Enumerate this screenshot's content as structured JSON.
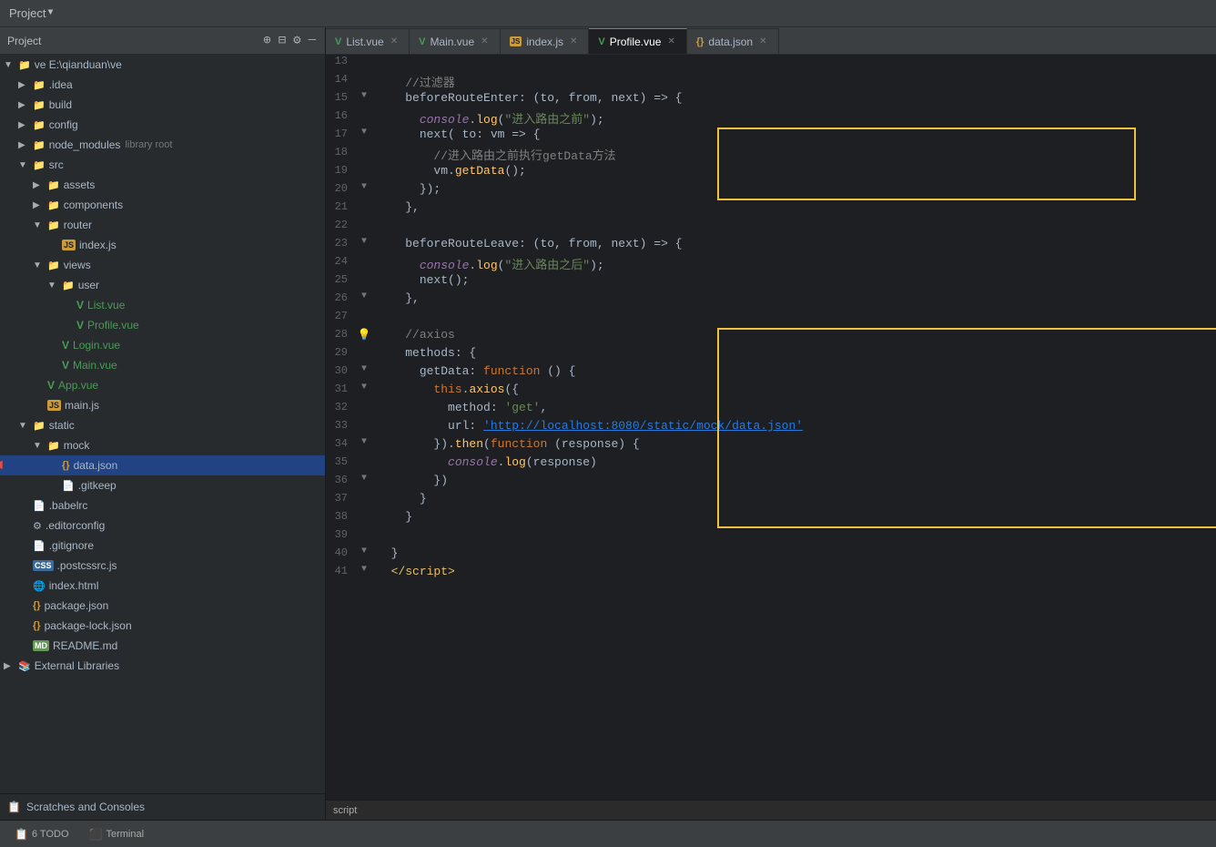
{
  "titleBar": {
    "title": "Project",
    "dropdownIcon": "▼"
  },
  "sidebar": {
    "header": {
      "title": "Project",
      "icons": [
        "+",
        "⊟",
        "⚙",
        "—"
      ]
    },
    "tree": [
      {
        "id": "ve-root",
        "level": 0,
        "arrow": "▼",
        "icon": "📁",
        "iconClass": "folder-blue",
        "label": "ve E:\\qianduan\\ve",
        "labelClass": ""
      },
      {
        "id": "idea",
        "level": 1,
        "arrow": "▶",
        "icon": "📁",
        "iconClass": "folder",
        "label": ".idea",
        "labelClass": ""
      },
      {
        "id": "build",
        "level": 1,
        "arrow": "▶",
        "icon": "📁",
        "iconClass": "folder",
        "label": "build",
        "labelClass": ""
      },
      {
        "id": "config",
        "level": 1,
        "arrow": "▶",
        "icon": "📁",
        "iconClass": "folder",
        "label": "config",
        "labelClass": ""
      },
      {
        "id": "node_modules",
        "level": 1,
        "arrow": "▶",
        "icon": "📁",
        "iconClass": "folder",
        "label": "node_modules",
        "extra": "library root",
        "labelClass": ""
      },
      {
        "id": "src",
        "level": 1,
        "arrow": "▼",
        "icon": "📁",
        "iconClass": "folder",
        "label": "src",
        "labelClass": ""
      },
      {
        "id": "assets",
        "level": 2,
        "arrow": "▶",
        "icon": "📁",
        "iconClass": "folder",
        "label": "assets",
        "labelClass": ""
      },
      {
        "id": "components",
        "level": 2,
        "arrow": "▶",
        "icon": "📁",
        "iconClass": "folder",
        "label": "components",
        "labelClass": ""
      },
      {
        "id": "router",
        "level": 2,
        "arrow": "▼",
        "icon": "📁",
        "iconClass": "folder",
        "label": "router",
        "labelClass": ""
      },
      {
        "id": "router-index",
        "level": 3,
        "arrow": "",
        "icon": "JS",
        "iconClass": "js-icon",
        "label": "index.js",
        "labelClass": ""
      },
      {
        "id": "views",
        "level": 2,
        "arrow": "▼",
        "icon": "📁",
        "iconClass": "folder",
        "label": "views",
        "labelClass": ""
      },
      {
        "id": "user",
        "level": 3,
        "arrow": "▼",
        "icon": "📁",
        "iconClass": "folder",
        "label": "user",
        "labelClass": ""
      },
      {
        "id": "list-vue",
        "level": 4,
        "arrow": "",
        "icon": "V",
        "iconClass": "vue-icon",
        "label": "List.vue",
        "labelClass": "vue-green"
      },
      {
        "id": "profile-vue",
        "level": 4,
        "arrow": "",
        "icon": "V",
        "iconClass": "vue-icon",
        "label": "Profile.vue",
        "labelClass": "vue-green"
      },
      {
        "id": "login-vue",
        "level": 3,
        "arrow": "",
        "icon": "V",
        "iconClass": "vue-icon",
        "label": "Login.vue",
        "labelClass": "vue-green"
      },
      {
        "id": "main-vue",
        "level": 3,
        "arrow": "",
        "icon": "V",
        "iconClass": "vue-icon",
        "label": "Main.vue",
        "labelClass": "vue-green"
      },
      {
        "id": "app-vue",
        "level": 2,
        "arrow": "",
        "icon": "V",
        "iconClass": "vue-icon",
        "label": "App.vue",
        "labelClass": "vue-green"
      },
      {
        "id": "main-js",
        "level": 2,
        "arrow": "",
        "icon": "JS",
        "iconClass": "js-icon",
        "label": "main.js",
        "labelClass": ""
      },
      {
        "id": "static",
        "level": 1,
        "arrow": "▼",
        "icon": "📁",
        "iconClass": "folder",
        "label": "static",
        "labelClass": ""
      },
      {
        "id": "mock",
        "level": 2,
        "arrow": "▼",
        "icon": "📁",
        "iconClass": "folder",
        "label": "mock",
        "labelClass": ""
      },
      {
        "id": "data-json",
        "level": 3,
        "arrow": "",
        "icon": "{}",
        "iconClass": "json-icon",
        "label": "data.json",
        "labelClass": "",
        "selected": true
      },
      {
        "id": "gitkeep",
        "level": 3,
        "arrow": "",
        "icon": "📄",
        "iconClass": "",
        "label": ".gitkeep",
        "labelClass": ""
      },
      {
        "id": "babelrc",
        "level": 1,
        "arrow": "",
        "icon": "📄",
        "iconClass": "",
        "label": ".babelrc",
        "labelClass": ""
      },
      {
        "id": "editorconfig",
        "level": 1,
        "arrow": "",
        "icon": "📄",
        "iconClass": "",
        "label": ".editorconfig",
        "labelClass": ""
      },
      {
        "id": "gitignore",
        "level": 1,
        "arrow": "",
        "icon": "📄",
        "iconClass": "",
        "label": ".gitignore",
        "labelClass": ""
      },
      {
        "id": "postcssrc",
        "level": 1,
        "arrow": "",
        "icon": "CSS",
        "iconClass": "css-icon",
        "label": ".postcssrc.js",
        "labelClass": ""
      },
      {
        "id": "index-html",
        "level": 1,
        "arrow": "",
        "icon": "🌐",
        "iconClass": "",
        "label": "index.html",
        "labelClass": ""
      },
      {
        "id": "package-json",
        "level": 1,
        "arrow": "",
        "icon": "{}",
        "iconClass": "json-icon",
        "label": "package.json",
        "labelClass": ""
      },
      {
        "id": "package-lock",
        "level": 1,
        "arrow": "",
        "icon": "{}",
        "iconClass": "json-icon",
        "label": "package-lock.json",
        "labelClass": ""
      },
      {
        "id": "readme",
        "level": 1,
        "arrow": "",
        "icon": "MD",
        "iconClass": "md-icon",
        "label": "README.md",
        "labelClass": ""
      },
      {
        "id": "ext-libs",
        "level": 0,
        "arrow": "▶",
        "icon": "📚",
        "iconClass": "",
        "label": "External Libraries",
        "labelClass": ""
      }
    ],
    "footer": {
      "scratches": "Scratches and Consoles"
    }
  },
  "tabs": [
    {
      "id": "list-vue-tab",
      "icon": "V",
      "iconClass": "vue-green",
      "label": "List.vue",
      "active": false
    },
    {
      "id": "main-vue-tab",
      "icon": "V",
      "iconClass": "vue-green",
      "label": "Main.vue",
      "active": false
    },
    {
      "id": "index-js-tab",
      "icon": "JS",
      "iconClass": "js-orange",
      "label": "index.js",
      "active": false
    },
    {
      "id": "profile-vue-tab",
      "icon": "V",
      "iconClass": "vue-green",
      "label": "Profile.vue",
      "active": true
    },
    {
      "id": "data-json-tab",
      "icon": "{}",
      "iconClass": "json-icon",
      "label": "data.json",
      "active": false
    }
  ],
  "codeLines": [
    {
      "num": "13",
      "gutter": "",
      "content": ""
    },
    {
      "num": "14",
      "gutter": "",
      "content": "    <span class='c-comment'>//过滤器</span>"
    },
    {
      "num": "15",
      "gutter": "▼",
      "content": "    <span class='c-prop'>beforeRouteEnter</span><span class='c-white'>: (to, from, next) =&gt; {</span>"
    },
    {
      "num": "16",
      "gutter": "",
      "content": "      <span class='c-italic'>console</span><span class='c-white'>.</span><span class='c-method'>log</span><span class='c-white'>(</span><span class='c-string'>\"进入路由之前\"</span><span class='c-white'>);</span>"
    },
    {
      "num": "17",
      "gutter": "▼",
      "content": "      <span class='c-prop'>next</span><span class='c-white'>( to: vm =&gt; {</span>",
      "highlight": true
    },
    {
      "num": "18",
      "gutter": "",
      "content": "        <span class='c-comment'>//进入路由之前执行getData方法</span>",
      "highlight": true
    },
    {
      "num": "19",
      "gutter": "",
      "content": "        <span class='c-white'>vm.</span><span class='c-method'>getData</span><span class='c-white'>();</span>",
      "highlight": true
    },
    {
      "num": "20",
      "gutter": "▼",
      "content": "      <span class='c-white'>});</span>",
      "highlight": true
    },
    {
      "num": "21",
      "gutter": "",
      "content": "    <span class='c-white'>},</span>"
    },
    {
      "num": "22",
      "gutter": "",
      "content": ""
    },
    {
      "num": "23",
      "gutter": "▼",
      "content": "    <span class='c-prop'>beforeRouteLeave</span><span class='c-white'>: (to, from, next) =&gt; {</span>"
    },
    {
      "num": "24",
      "gutter": "",
      "content": "      <span class='c-italic'>console</span><span class='c-white'>.</span><span class='c-method'>log</span><span class='c-white'>(</span><span class='c-string'>\"进入路由之后\"</span><span class='c-white'>);</span>"
    },
    {
      "num": "25",
      "gutter": "",
      "content": "      <span class='c-prop'>next</span><span class='c-white'>();</span>"
    },
    {
      "num": "26",
      "gutter": "▼",
      "content": "    <span class='c-white'>},</span>"
    },
    {
      "num": "27",
      "gutter": "",
      "content": ""
    },
    {
      "num": "28",
      "gutter": "💡",
      "content": "    <span class='c-comment'>//axios</span>",
      "highlight2": true
    },
    {
      "num": "29",
      "gutter": "",
      "content": "    <span class='c-prop'>methods</span><span class='c-white'>: {</span>",
      "highlight2": true
    },
    {
      "num": "30",
      "gutter": "▼",
      "content": "      <span class='c-prop'>getData</span><span class='c-white'>: </span><span class='c-keyword'>function</span><span class='c-white'> () {</span>",
      "highlight2": true
    },
    {
      "num": "31",
      "gutter": "▼",
      "content": "        <span class='c-keyword'>this</span><span class='c-white'>.</span><span class='c-method'>axios</span><span class='c-white'>({</span>",
      "highlight2": true
    },
    {
      "num": "32",
      "gutter": "",
      "content": "          <span class='c-prop'>method</span><span class='c-white'>: </span><span class='c-string'>'get'</span><span class='c-white'>,</span>",
      "highlight2": true
    },
    {
      "num": "33",
      "gutter": "",
      "content": "          <span class='c-prop'>url</span><span class='c-white'>: </span><span class='c-string-url'>'http://localhost:8080/static/mock/data.json'</span>",
      "highlight2": true
    },
    {
      "num": "34",
      "gutter": "▼",
      "content": "        <span class='c-white'>}).</span><span class='c-method'>then</span><span class='c-white'>(</span><span class='c-keyword'>function</span><span class='c-white'> (response) {</span>",
      "highlight2": true
    },
    {
      "num": "35",
      "gutter": "",
      "content": "          <span class='c-italic'>console</span><span class='c-white'>.</span><span class='c-method'>log</span><span class='c-white'>(response)</span>",
      "highlight2": true
    },
    {
      "num": "36",
      "gutter": "▼",
      "content": "        <span class='c-white'>})</span>",
      "highlight2": true
    },
    {
      "num": "37",
      "gutter": "",
      "content": "      <span class='c-white'>}</span>",
      "highlight2": true
    },
    {
      "num": "38",
      "gutter": "",
      "content": "    <span class='c-white'>}</span>",
      "highlight2": true
    },
    {
      "num": "39",
      "gutter": "",
      "content": ""
    },
    {
      "num": "40",
      "gutter": "▼",
      "content": "  <span class='c-white'>}</span>"
    },
    {
      "num": "41",
      "gutter": "▼",
      "content": "  <span class='c-tag'>&lt;/script&gt;</span>"
    }
  ],
  "breadcrumb": "script",
  "statusBar": {
    "todo": "6 TODO",
    "terminal": "Terminal"
  }
}
